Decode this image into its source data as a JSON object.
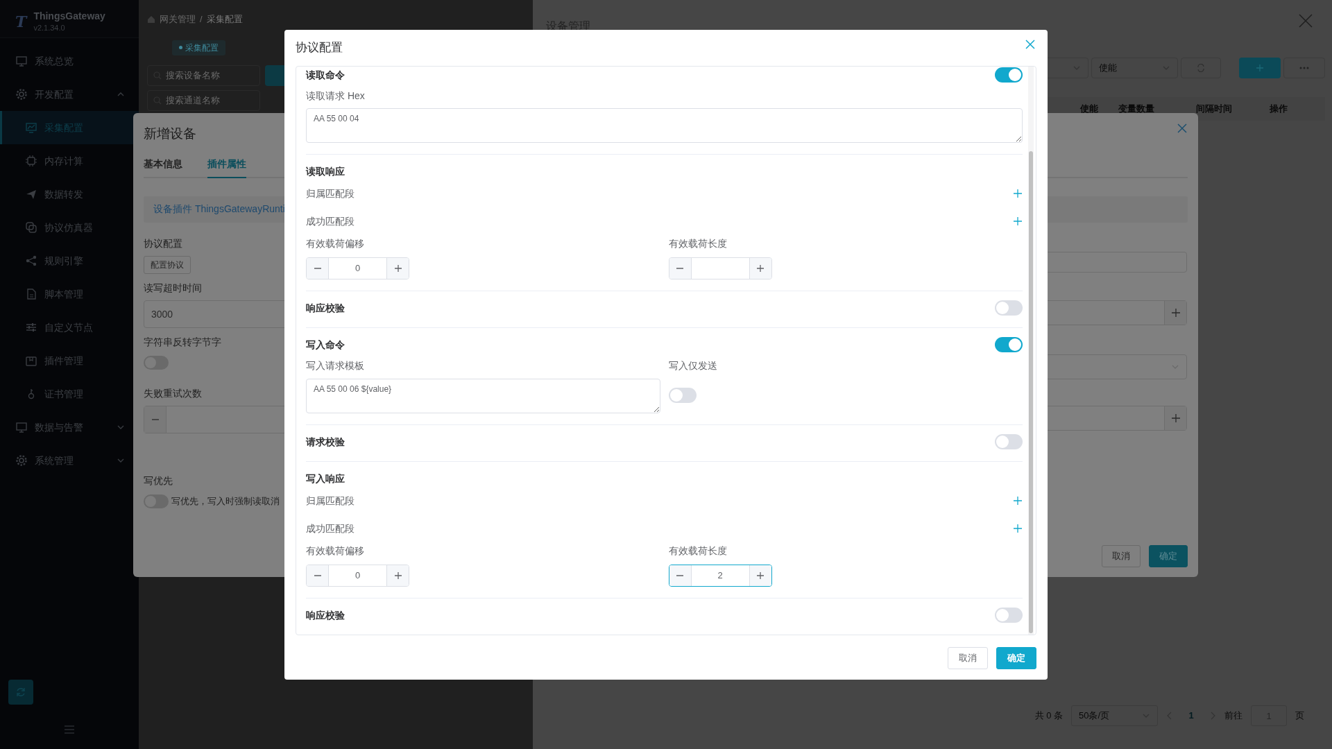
{
  "sidebar": {
    "logo": "T",
    "app_name": "ThingsGateway",
    "version": "v2.1.34.0",
    "items": [
      {
        "label": "系统总览",
        "kind": "link",
        "selected": false
      },
      {
        "label": "开发配置",
        "kind": "group",
        "expanded": true,
        "selected": false,
        "children": [
          {
            "label": "采集配置",
            "selected": true
          },
          {
            "label": "内存计算",
            "selected": false
          },
          {
            "label": "数据转发",
            "selected": false
          },
          {
            "label": "协议仿真器",
            "selected": false
          },
          {
            "label": "规则引擎",
            "selected": false
          },
          {
            "label": "脚本管理",
            "selected": false
          },
          {
            "label": "自定义节点",
            "selected": false
          },
          {
            "label": "插件管理",
            "selected": false
          },
          {
            "label": "证书管理",
            "selected": false
          }
        ]
      },
      {
        "label": "数据与告警",
        "kind": "group",
        "expanded": false,
        "selected": false
      },
      {
        "label": "系统管理",
        "kind": "group",
        "expanded": false,
        "selected": false
      }
    ]
  },
  "main": {
    "breadcrumb": [
      "网关管理",
      "采集配置"
    ],
    "breadcrumb_separator": "/",
    "tab": "采集配置",
    "search_placeholders": [
      "搜索设备名称",
      "搜索通道名称"
    ]
  },
  "device_drawer": {
    "title": "设备管理",
    "filter_placeholder": "使能",
    "columns": [
      "使能",
      "变量数量",
      "间隔时间",
      "操作"
    ],
    "pagination": {
      "total": "共 0 条",
      "page_size": "50条/页",
      "pages": [
        {
          "label": "1",
          "selected": true
        }
      ],
      "goto_label": "前往",
      "goto_value": "1",
      "page_suffix": "页"
    }
  },
  "add_device_dialog": {
    "title": "新增设备",
    "tabs": [
      {
        "label": "基本信息",
        "selected": false
      },
      {
        "label": "插件属性",
        "selected": true
      }
    ],
    "plugin_notice": "设备插件 ThingsGatewayRunti",
    "fields": [
      {
        "kind": "button",
        "label": "协议配置",
        "button": "配置协议"
      },
      {
        "kind": "text",
        "label": "读写超时时间",
        "value": "3000"
      },
      {
        "kind": "switch",
        "label": "字符串反转字节字",
        "on": false
      },
      {
        "kind": "number",
        "label": "失败重试次数"
      },
      {
        "kind": "switch",
        "label": "写优先",
        "on": false,
        "description": "写优先，写入时强制读取消"
      }
    ],
    "buttons": [
      {
        "label": "取消",
        "kind": "secondary"
      },
      {
        "label": "确定",
        "kind": "primary"
      }
    ]
  },
  "protocol_dialog": {
    "title": "协议配置",
    "groups": [
      [
        {
          "kind": "toggle",
          "label": "读取命令",
          "on": true
        },
        {
          "kind": "textarea",
          "label": "读取请求 Hex",
          "value": "AA 55 00 04"
        }
      ],
      [
        {
          "kind": "heading",
          "label": "读取响应"
        },
        {
          "kind": "add",
          "label": "归属匹配段"
        },
        {
          "kind": "add",
          "label": "成功匹配段"
        },
        {
          "kind": "numbers",
          "fields": [
            {
              "label": "有效载荷偏移",
              "value": "0",
              "focused": false
            },
            {
              "label": "有效载荷长度",
              "focused": false
            }
          ]
        }
      ],
      [
        {
          "kind": "toggle",
          "label": "响应校验",
          "on": false
        }
      ],
      [
        {
          "kind": "toggle",
          "label": "写入命令",
          "on": true
        },
        {
          "kind": "pair",
          "left": {
            "label": "写入请求模板",
            "value": "AA 55 00 06 ${value}"
          },
          "right": {
            "label": "写入仅发送",
            "on": false
          }
        }
      ],
      [
        {
          "kind": "toggle",
          "label": "请求校验",
          "on": false
        }
      ],
      [
        {
          "kind": "heading",
          "label": "写入响应"
        },
        {
          "kind": "add",
          "label": "归属匹配段"
        },
        {
          "kind": "add",
          "label": "成功匹配段"
        },
        {
          "kind": "numbers",
          "fields": [
            {
              "label": "有效载荷偏移",
              "value": "0",
              "focused": false
            },
            {
              "label": "有效载荷长度",
              "value": "2",
              "focused": true
            }
          ]
        }
      ],
      [
        {
          "kind": "toggle",
          "label": "响应校验",
          "on": false
        }
      ]
    ],
    "buttons": [
      {
        "label": "取消",
        "kind": "secondary"
      },
      {
        "label": "确定",
        "kind": "primary"
      }
    ]
  }
}
